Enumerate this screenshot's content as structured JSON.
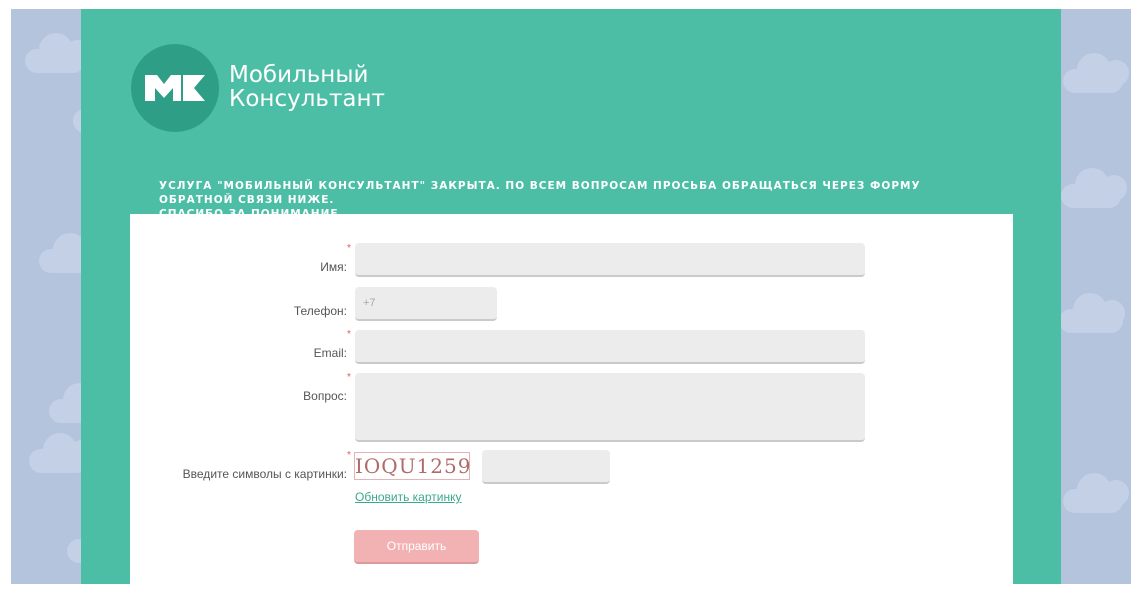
{
  "logo": {
    "line1": "Мобильный",
    "line2": "Консультант",
    "mark": "MK-logo-icon"
  },
  "notice": {
    "line1": "УСЛУГА \"МОБИЛЬНЫЙ КОНСУЛЬТАНТ\" ЗАКРЫТА. ПО ВСЕМ ВОПРОСАМ ПРОСЬБА ОБРАЩАТЬСЯ ЧЕРЕЗ ФОРМУ ОБРАТНОЙ СВЯЗИ НИЖЕ.",
    "line2": "СПАСИБО ЗА ПОНИМАНИЕ."
  },
  "form": {
    "name_label": "Имя:",
    "name_value": "",
    "phone_label": "Телефон:",
    "phone_value": "+7",
    "email_label": "Email:",
    "email_value": "",
    "question_label": "Вопрос:",
    "question_value": "",
    "captcha_label": "Введите символы с картинки:",
    "captcha_text": "IOQU1259",
    "captcha_value": "",
    "refresh_label": "Обновить картинку",
    "submit_label": "Отправить",
    "required_mark": "*"
  },
  "colors": {
    "page_background": "#b5c4dd",
    "panel": "#4cbea6",
    "logo_circle": "#2f9e86",
    "submit": "#f2b2b3",
    "link": "#3aa98a",
    "required": "#e05a5a"
  }
}
